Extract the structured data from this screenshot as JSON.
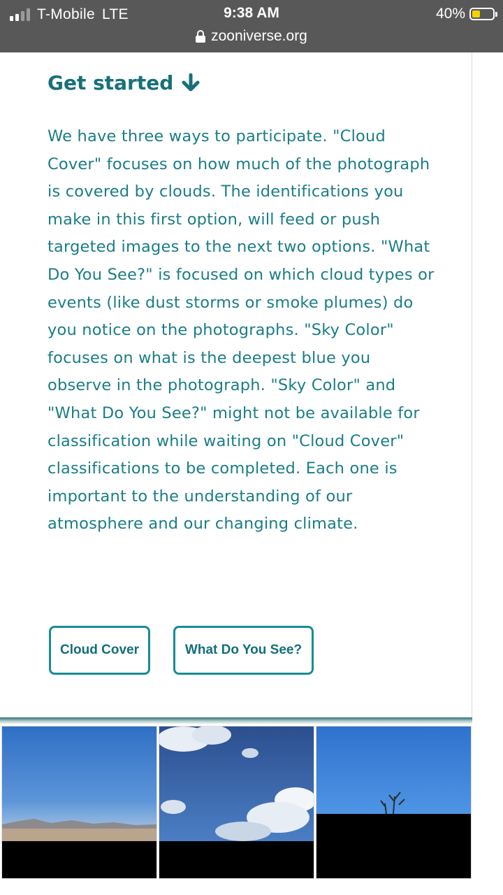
{
  "status_bar": {
    "carrier": "T-Mobile",
    "network": "LTE",
    "time": "9:38 AM",
    "battery": "40%",
    "battery_level": 0.4,
    "url": "zooniverse.org"
  },
  "content": {
    "heading": "Get started",
    "heading_icon": "arrow-down-icon",
    "body": "We have three ways to participate. \"Cloud Cover\" focuses on how much of the photograph is covered by clouds. The identifications you make in this first option, will feed or push targeted images to the next two options. \"What Do You See?\" is focused on which cloud types or events (like dust storms or smoke plumes) do you notice on the photographs. \"Sky Color\" focuses on what is the deepest blue you observe in the photograph. \"Sky Color\" and \"What Do You See?\" might not be available for classification while waiting on \"Cloud Cover\" classifications to be completed. Each one is important to the understanding of our atmosphere and our changing climate.",
    "buttons": {
      "cloud_cover": "Cloud Cover",
      "what_do_you_see": "What Do You See?"
    }
  },
  "colors": {
    "accent": "#17707a",
    "text": "#1b7d86",
    "button_border": "#178d94",
    "status_bar_bg": "#585858"
  },
  "gallery": {
    "images": [
      {
        "subject": "desert landscape under clear blue sky"
      },
      {
        "subject": "blue sky with cumulus clouds"
      },
      {
        "subject": "clear blue sky with bare tree tops"
      }
    ]
  }
}
